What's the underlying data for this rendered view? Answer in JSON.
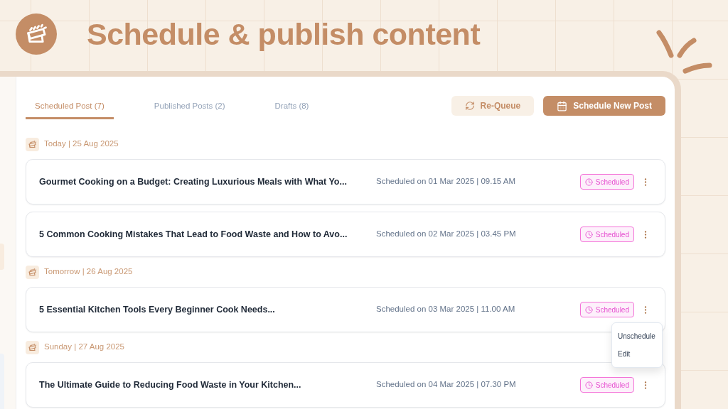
{
  "header": {
    "title": "Schedule & publish content"
  },
  "tabs": [
    {
      "label": "Scheduled Post (7)",
      "selected": true
    },
    {
      "label": "Published Posts (2)",
      "selected": false
    },
    {
      "label": "Drafts (8)",
      "selected": false
    }
  ],
  "actions": [
    {
      "label": "Re-Queue",
      "kind": "secondary"
    },
    {
      "label": "Schedule New Post",
      "kind": "primary"
    }
  ],
  "groups": [
    {
      "day": "Today | 25 Aug 2025",
      "posts": [
        {
          "title": "Gourmet Cooking on a Budget: Creating Luxurious Meals with What Yo...",
          "schedule": "Scheduled on 01 Mar 2025 | 09.15 AM",
          "status": "Scheduled",
          "kind": "scheduled"
        },
        {
          "title": "5 Common Cooking Mistakes That Lead to Food Waste and How to Avo...",
          "schedule": "Scheduled on 02 Mar 2025 | 03.45 PM",
          "status": "Scheduled",
          "kind": "scheduled"
        }
      ]
    },
    {
      "day": "Tomorrow | 26 Aug 2025",
      "posts": [
        {
          "title": "5 Essential Kitchen Tools Every Beginner Cook Needs...",
          "schedule": "Scheduled on 03 Mar 2025 | 11.00 AM",
          "status": "Scheduled",
          "kind": "scheduled",
          "menu": [
            "Unschedule",
            "Edit"
          ]
        }
      ]
    },
    {
      "day": "Sunday | 27 Aug 2025",
      "posts": [
        {
          "title": "The Ultimate Guide to Reducing Food Waste in Your Kitchen...",
          "schedule": "Scheduled on 04 Mar 2025 | 07.30 PM",
          "status": "Scheduled",
          "kind": "scheduled"
        }
      ]
    }
  ]
}
